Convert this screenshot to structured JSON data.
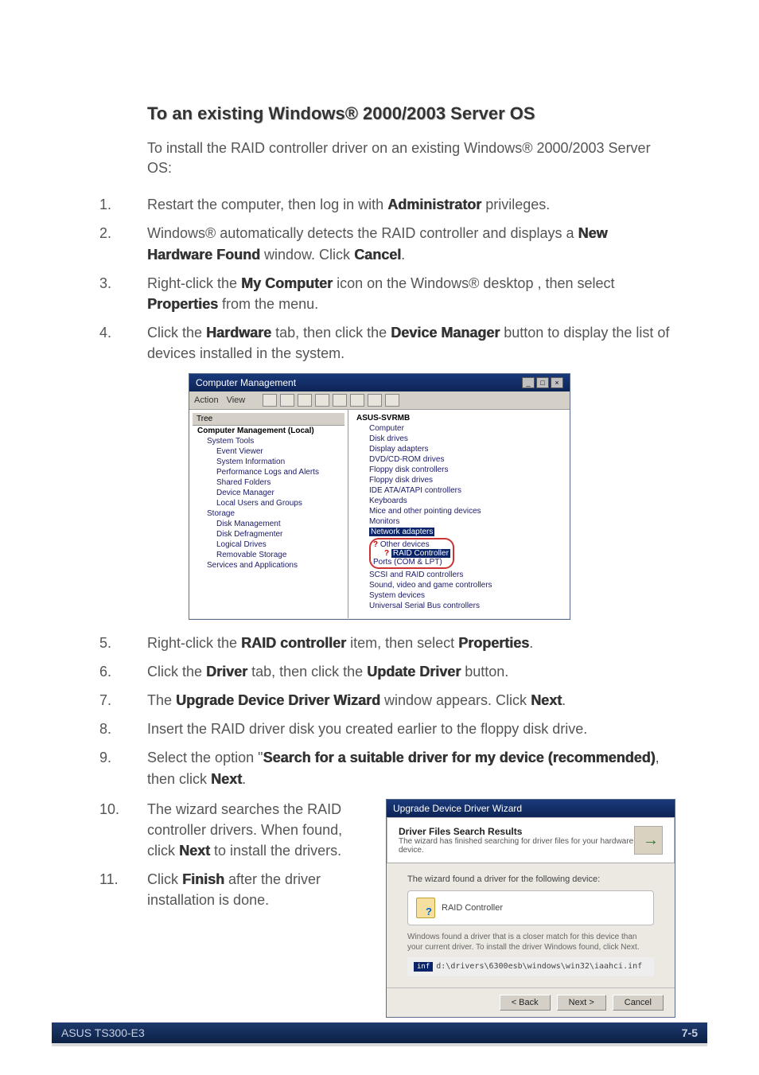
{
  "title": "To an existing Windows® 2000/2003 Server OS",
  "intro": "To install the RAID controller driver on an existing Windows® 2000/2003 Server OS:",
  "steps": {
    "s1a": "Restart the computer, then log in with ",
    "s1b": "Administrator",
    "s1c": " privileges.",
    "s2a": "Windows® automatically detects the RAID controller and displays a ",
    "s2b": "New Hardware Found",
    "s2c": " window. Click ",
    "s2d": "Cancel",
    "s2e": ".",
    "s3a": "Right-click the ",
    "s3b": "My Computer",
    "s3c": " icon on the Windows® desktop , then select ",
    "s3d": "Properties",
    "s3e": " from the menu.",
    "s4a": "Click the ",
    "s4b": "Hardware",
    "s4c": " tab, then click the ",
    "s4d": "Device Manager",
    "s4e": " button to display the list of devices installed in the system.",
    "s5a": "Right-click the ",
    "s5b": "RAID controller",
    "s5c": " item, then select ",
    "s5d": "Properties",
    "s5e": ".",
    "s6a": "Click the ",
    "s6b": "Driver",
    "s6c": " tab, then click the ",
    "s6d": "Update Driver",
    "s6e": " button.",
    "s7a": "The ",
    "s7b": "Upgrade Device Driver Wizard",
    "s7c": " window appears. Click ",
    "s7d": "Next",
    "s7e": ".",
    "s8a": "Insert the RAID driver disk you created earlier to the floppy disk drive.",
    "s9a": "Select the option \"",
    "s9b": "Search for a suitable driver for my device (recommended)",
    "s9c": ", then click ",
    "s9d": "Next",
    "s9e": ".",
    "s10a": "The wizard searches the RAID controller drivers. When found, click ",
    "s10b": "Next",
    "s10c": " to install the drivers.",
    "s11a": "Click ",
    "s11b": "Finish",
    "s11c": " after the driver installation is done."
  },
  "shot1": {
    "title": "Computer Management",
    "menu_action": "Action",
    "menu_view": "View",
    "left_header": "Tree",
    "left_items": [
      "Computer Management (Local)",
      "System Tools",
      "Event Viewer",
      "System Information",
      "Performance Logs and Alerts",
      "Shared Folders",
      "Device Manager",
      "Local Users and Groups",
      "Storage",
      "Disk Management",
      "Disk Defragmenter",
      "Logical Drives",
      "Removable Storage",
      "Services and Applications"
    ],
    "right_root": "ASUS-SVRMB",
    "right_items": [
      "Computer",
      "Disk drives",
      "Display adapters",
      "DVD/CD-ROM drives",
      "Floppy disk controllers",
      "Floppy disk drives",
      "IDE ATA/ATAPI controllers",
      "Keyboards",
      "Mice and other pointing devices",
      "Monitors",
      "Network adapters",
      "Other devices",
      "RAID Controller",
      "Ports (COM & LPT)",
      "SCSI and RAID controllers",
      "Sound, video and game controllers",
      "System devices",
      "Universal Serial Bus controllers"
    ]
  },
  "shot2": {
    "title": "Upgrade Device Driver Wizard",
    "header_title": "Driver Files Search Results",
    "header_sub": "The wizard has finished searching for driver files for your hardware device.",
    "found_label": "The wizard found a driver for the following device:",
    "device_name": "RAID Controller",
    "windows_text": "Windows found a driver that is a closer match for this device than your current driver. To install the driver Windows found, click Next.",
    "path_label": "d:\\drivers\\6300esb\\windows\\win32\\iaahci.inf",
    "back": "< Back",
    "next": "Next >",
    "cancel": "Cancel"
  },
  "footer": {
    "left": "ASUS TS300-E3",
    "right": "7-5"
  }
}
